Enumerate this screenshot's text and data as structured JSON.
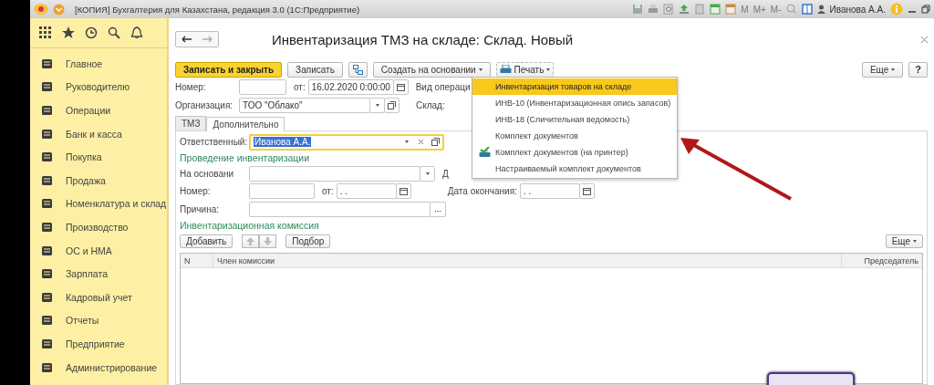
{
  "window": {
    "title": "[КОПИЯ] Бухгалтерия для Казахстана, редакция 3.0  (1С:Предприятие)",
    "memory_buttons": [
      "M",
      "M+",
      "M-"
    ],
    "user": "Иванова А.А."
  },
  "sidebar": {
    "items": [
      {
        "label": "Главное"
      },
      {
        "label": "Руководителю"
      },
      {
        "label": "Операции"
      },
      {
        "label": "Банк и касса"
      },
      {
        "label": "Покупка"
      },
      {
        "label": "Продажа"
      },
      {
        "label": "Номенклатура и склад"
      },
      {
        "label": "Производство"
      },
      {
        "label": "ОС и НМА"
      },
      {
        "label": "Зарплата"
      },
      {
        "label": "Кадровый учет"
      },
      {
        "label": "Отчеты"
      },
      {
        "label": "Предприятие"
      },
      {
        "label": "Администрирование"
      }
    ]
  },
  "document": {
    "title": "Инвентаризация ТМЗ на складе: Склад. Новый",
    "toolbar": {
      "save_close": "Записать и закрыть",
      "save": "Записать",
      "create_based": "Создать на основании",
      "print": "Печать",
      "more": "Еще",
      "help": "?"
    },
    "header_fields": {
      "number_label": "Номер:",
      "date_label": "от:",
      "date_value": "16.02.2020  0:00:00",
      "operation_label": "Вид операци",
      "org_label": "Организация:",
      "org_value": "ТОО \"Облако\"",
      "warehouse_label": "Склад:"
    },
    "tabs": [
      {
        "label": "ТМЗ",
        "selected": false
      },
      {
        "label": "Дополнительно",
        "selected": true
      }
    ],
    "responsible": {
      "label": "Ответственный:",
      "value": "Иванова А.А."
    },
    "conduct": {
      "heading": "Проведение инвентаризации",
      "basis_label": "На основани",
      "start_label": "Д",
      "number_label": "Номер:",
      "date_label": "от:",
      "date_value": ". .",
      "end_label": "Дата окончания:",
      "end_value": ". .",
      "reason_label": "Причина:",
      "reason_button": "..."
    },
    "commission": {
      "heading": "Инвентаризационная комиссия",
      "add": "Добавить",
      "pick": "Подбор",
      "more": "Еще",
      "columns": [
        "N",
        "Член комиссии",
        "Председатель"
      ]
    }
  },
  "print_menu": [
    {
      "label": "Инвентаризация товаров на складе",
      "selected": true,
      "kind": "plain"
    },
    {
      "label": "ИНВ-10 (Инвентаризационная опись запасов)",
      "selected": false,
      "kind": "plain"
    },
    {
      "label": "ИНВ-18 (Сличительная ведомость)",
      "selected": false,
      "kind": "plain"
    },
    {
      "label": "Комплект документов",
      "selected": false,
      "kind": "plain"
    },
    {
      "label": "Комплект документов (на принтер)",
      "selected": false,
      "kind": "printer"
    },
    {
      "label": "Настраиваемый комплект документов",
      "selected": false,
      "kind": "plain"
    }
  ]
}
